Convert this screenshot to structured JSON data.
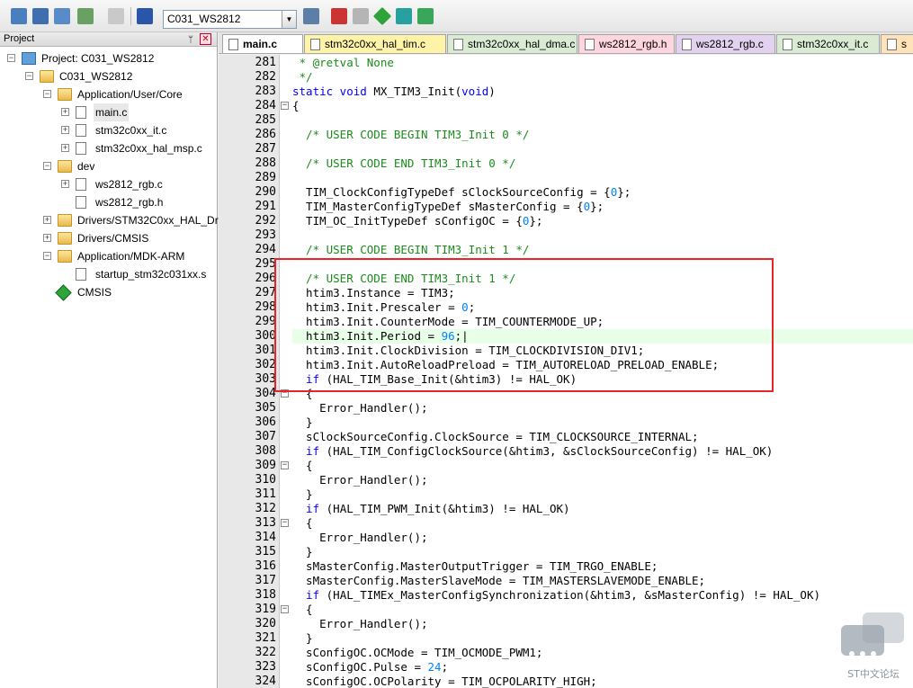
{
  "toolbar": {
    "target": "C031_WS2812"
  },
  "project_panel": {
    "title": "Project",
    "pin": "ᛘ",
    "close": "✕",
    "tree": [
      {
        "label": "Project: C031_WS2812",
        "level": 0,
        "icon": "project",
        "expander": "−"
      },
      {
        "label": "C031_WS2812",
        "level": 1,
        "icon": "target",
        "expander": "−"
      },
      {
        "label": "Application/User/Core",
        "level": 2,
        "icon": "folder",
        "expander": "−"
      },
      {
        "label": "main.c",
        "level": 3,
        "icon": "file",
        "expander": "+",
        "selected": true
      },
      {
        "label": "stm32c0xx_it.c",
        "level": 3,
        "icon": "file",
        "expander": "+"
      },
      {
        "label": "stm32c0xx_hal_msp.c",
        "level": 3,
        "icon": "file",
        "expander": "+"
      },
      {
        "label": "dev",
        "level": 2,
        "icon": "folder",
        "expander": "−"
      },
      {
        "label": "ws2812_rgb.c",
        "level": 3,
        "icon": "file",
        "expander": "+"
      },
      {
        "label": "ws2812_rgb.h",
        "level": 3,
        "icon": "file",
        "expander": ""
      },
      {
        "label": "Drivers/STM32C0xx_HAL_Driver",
        "level": 2,
        "icon": "folder",
        "expander": "+"
      },
      {
        "label": "Drivers/CMSIS",
        "level": 2,
        "icon": "folder",
        "expander": "+"
      },
      {
        "label": "Application/MDK-ARM",
        "level": 2,
        "icon": "folder",
        "expander": "−"
      },
      {
        "label": "startup_stm32c031xx.s",
        "level": 3,
        "icon": "file",
        "expander": ""
      },
      {
        "label": "CMSIS",
        "level": 2,
        "icon": "cmsis",
        "expander": ""
      }
    ]
  },
  "tabs": [
    {
      "label": "main.c",
      "active": true,
      "color": "#ffffff"
    },
    {
      "label": "stm32c0xx_hal_tim.c",
      "active": false,
      "color": "#fff3a8"
    },
    {
      "label": "stm32c0xx_hal_dma.c",
      "active": false,
      "color": "#d9ecd3"
    },
    {
      "label": "ws2812_rgb.h",
      "active": false,
      "color": "#ffd6df"
    },
    {
      "label": "ws2812_rgb.c",
      "active": false,
      "color": "#e2d2f0"
    },
    {
      "label": "stm32c0xx_it.c",
      "active": false,
      "color": "#d9ecd3"
    },
    {
      "label": "s",
      "active": false,
      "color": "#ffe3b8"
    }
  ],
  "code": [
    {
      "n": "281",
      "fold": "",
      "tokens": [
        [
          "comment",
          " * @retval None"
        ]
      ]
    },
    {
      "n": "282",
      "fold": "",
      "tokens": [
        [
          "comment",
          " */"
        ]
      ]
    },
    {
      "n": "283",
      "fold": "",
      "tokens": [
        [
          "keyword",
          "static void "
        ],
        [
          "plain",
          "MX_TIM3_Init("
        ],
        [
          "keyword",
          "void"
        ],
        [
          "plain",
          ")"
        ]
      ]
    },
    {
      "n": "284",
      "fold": "−",
      "tokens": [
        [
          "plain",
          "{"
        ]
      ]
    },
    {
      "n": "285",
      "fold": "",
      "tokens": [
        [
          "plain",
          ""
        ]
      ]
    },
    {
      "n": "286",
      "fold": "",
      "tokens": [
        [
          "comment",
          "  /* USER CODE BEGIN TIM3_Init 0 */"
        ]
      ]
    },
    {
      "n": "287",
      "fold": "",
      "tokens": [
        [
          "plain",
          ""
        ]
      ]
    },
    {
      "n": "288",
      "fold": "",
      "tokens": [
        [
          "comment",
          "  /* USER CODE END TIM3_Init 0 */"
        ]
      ]
    },
    {
      "n": "289",
      "fold": "",
      "tokens": [
        [
          "plain",
          ""
        ]
      ]
    },
    {
      "n": "290",
      "fold": "",
      "tokens": [
        [
          "plain",
          "  TIM_ClockConfigTypeDef sClockSourceConfig = {"
        ],
        [
          "number",
          "0"
        ],
        [
          "plain",
          "};"
        ]
      ]
    },
    {
      "n": "291",
      "fold": "",
      "tokens": [
        [
          "plain",
          "  TIM_MasterConfigTypeDef sMasterConfig = {"
        ],
        [
          "number",
          "0"
        ],
        [
          "plain",
          "};"
        ]
      ]
    },
    {
      "n": "292",
      "fold": "",
      "tokens": [
        [
          "plain",
          "  TIM_OC_InitTypeDef sConfigOC = {"
        ],
        [
          "number",
          "0"
        ],
        [
          "plain",
          "};"
        ]
      ]
    },
    {
      "n": "293",
      "fold": "",
      "tokens": [
        [
          "plain",
          ""
        ]
      ]
    },
    {
      "n": "294",
      "fold": "",
      "tokens": [
        [
          "comment",
          "  /* USER CODE BEGIN TIM3_Init 1 */"
        ]
      ]
    },
    {
      "n": "295",
      "fold": "",
      "tokens": [
        [
          "plain",
          ""
        ]
      ]
    },
    {
      "n": "296",
      "fold": "",
      "tokens": [
        [
          "comment",
          "  /* USER CODE END TIM3_Init 1 */"
        ]
      ]
    },
    {
      "n": "297",
      "fold": "",
      "tokens": [
        [
          "plain",
          "  htim3.Instance = TIM3;"
        ]
      ]
    },
    {
      "n": "298",
      "fold": "",
      "tokens": [
        [
          "plain",
          "  htim3.Init.Prescaler = "
        ],
        [
          "number",
          "0"
        ],
        [
          "plain",
          ";"
        ]
      ]
    },
    {
      "n": "299",
      "fold": "",
      "tokens": [
        [
          "plain",
          "  htim3.Init.CounterMode = TIM_COUNTERMODE_UP;"
        ]
      ]
    },
    {
      "n": "300",
      "fold": "",
      "highlight": true,
      "tokens": [
        [
          "plain",
          "  htim3.Init.Period = "
        ],
        [
          "number",
          "96"
        ],
        [
          "plain",
          ";|"
        ]
      ]
    },
    {
      "n": "301",
      "fold": "",
      "tokens": [
        [
          "plain",
          "  htim3.Init.ClockDivision = TIM_CLOCKDIVISION_DIV1;"
        ]
      ]
    },
    {
      "n": "302",
      "fold": "",
      "tokens": [
        [
          "plain",
          "  htim3.Init.AutoReloadPreload = TIM_AUTORELOAD_PRELOAD_ENABLE;"
        ]
      ]
    },
    {
      "n": "303",
      "fold": "",
      "tokens": [
        [
          "keyword",
          "  if "
        ],
        [
          "plain",
          "(HAL_TIM_Base_Init(&htim3) != HAL_OK)"
        ]
      ]
    },
    {
      "n": "304",
      "fold": "−",
      "tokens": [
        [
          "plain",
          "  {"
        ]
      ]
    },
    {
      "n": "305",
      "fold": "",
      "tokens": [
        [
          "plain",
          "    Error_Handler();"
        ]
      ]
    },
    {
      "n": "306",
      "fold": "",
      "tokens": [
        [
          "plain",
          "  }"
        ]
      ]
    },
    {
      "n": "307",
      "fold": "",
      "tokens": [
        [
          "plain",
          "  sClockSourceConfig.ClockSource = TIM_CLOCKSOURCE_INTERNAL;"
        ]
      ]
    },
    {
      "n": "308",
      "fold": "",
      "tokens": [
        [
          "keyword",
          "  if "
        ],
        [
          "plain",
          "(HAL_TIM_ConfigClockSource(&htim3, &sClockSourceConfig) != HAL_OK)"
        ]
      ]
    },
    {
      "n": "309",
      "fold": "−",
      "tokens": [
        [
          "plain",
          "  {"
        ]
      ]
    },
    {
      "n": "310",
      "fold": "",
      "tokens": [
        [
          "plain",
          "    Error_Handler();"
        ]
      ]
    },
    {
      "n": "311",
      "fold": "",
      "tokens": [
        [
          "plain",
          "  }"
        ]
      ]
    },
    {
      "n": "312",
      "fold": "",
      "tokens": [
        [
          "keyword",
          "  if "
        ],
        [
          "plain",
          "(HAL_TIM_PWM_Init(&htim3) != HAL_OK)"
        ]
      ]
    },
    {
      "n": "313",
      "fold": "−",
      "tokens": [
        [
          "plain",
          "  {"
        ]
      ]
    },
    {
      "n": "314",
      "fold": "",
      "tokens": [
        [
          "plain",
          "    Error_Handler();"
        ]
      ]
    },
    {
      "n": "315",
      "fold": "",
      "tokens": [
        [
          "plain",
          "  }"
        ]
      ]
    },
    {
      "n": "316",
      "fold": "",
      "tokens": [
        [
          "plain",
          "  sMasterConfig.MasterOutputTrigger = TIM_TRGO_ENABLE;"
        ]
      ]
    },
    {
      "n": "317",
      "fold": "",
      "tokens": [
        [
          "plain",
          "  sMasterConfig.MasterSlaveMode = TIM_MASTERSLAVEMODE_ENABLE;"
        ]
      ]
    },
    {
      "n": "318",
      "fold": "",
      "tokens": [
        [
          "keyword",
          "  if "
        ],
        [
          "plain",
          "(HAL_TIMEx_MasterConfigSynchronization(&htim3, &sMasterConfig) != HAL_OK)"
        ]
      ]
    },
    {
      "n": "319",
      "fold": "−",
      "tokens": [
        [
          "plain",
          "  {"
        ]
      ]
    },
    {
      "n": "320",
      "fold": "",
      "tokens": [
        [
          "plain",
          "    Error_Handler();"
        ]
      ]
    },
    {
      "n": "321",
      "fold": "",
      "tokens": [
        [
          "plain",
          "  }"
        ]
      ]
    },
    {
      "n": "322",
      "fold": "",
      "tokens": [
        [
          "plain",
          "  sConfigOC.OCMode = TIM_OCMODE_PWM1;"
        ]
      ]
    },
    {
      "n": "323",
      "fold": "",
      "tokens": [
        [
          "plain",
          "  sConfigOC.Pulse = "
        ],
        [
          "number",
          "24"
        ],
        [
          "plain",
          ";"
        ]
      ]
    },
    {
      "n": "324",
      "fold": "",
      "tokens": [
        [
          "plain",
          "  sConfigOC.OCPolarity = TIM_OCPOLARITY_HIGH;"
        ]
      ]
    }
  ],
  "watermark": {
    "text": "ST中文论坛"
  }
}
